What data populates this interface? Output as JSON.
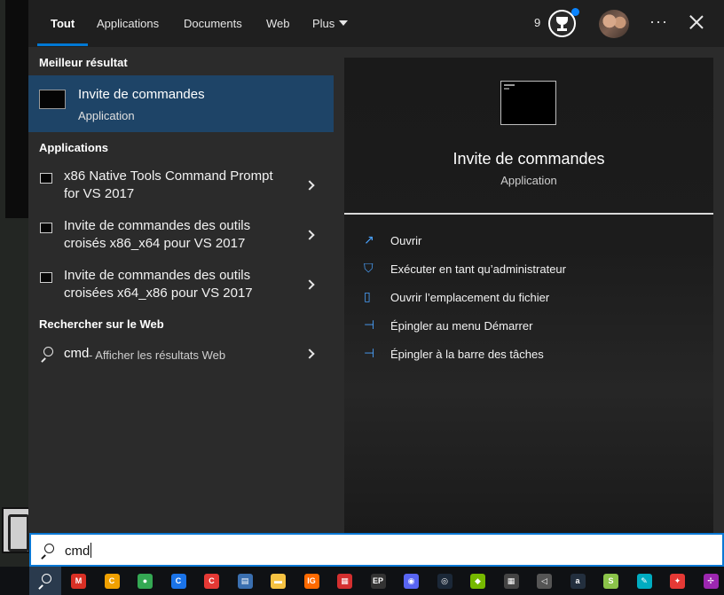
{
  "tabs": [
    {
      "label": "Tout",
      "active": true
    },
    {
      "label": "Applications"
    },
    {
      "label": "Documents"
    },
    {
      "label": "Web"
    },
    {
      "label": "Plus"
    }
  ],
  "header": {
    "badge_count": "9"
  },
  "sections": {
    "best": "Meilleur résultat",
    "apps": "Applications",
    "web": "Rechercher sur le Web"
  },
  "best_match": {
    "title": "Invite de commandes",
    "subtitle": "Application"
  },
  "apps": [
    {
      "line1": "x86 Native Tools Command Prompt",
      "line2": "for VS 2017"
    },
    {
      "line1": "Invite de commandes des outils",
      "line2": "croisés x86_x64 pour VS 2017"
    },
    {
      "line1": "Invite de commandes des outils",
      "line2": "croisées x64_x86 pour VS 2017"
    }
  ],
  "web_result": {
    "query": "cmd",
    "hint": "- Afficher les résultats Web"
  },
  "preview": {
    "title": "Invite de commandes",
    "subtitle": "Application"
  },
  "actions": [
    {
      "label": "Ouvrir",
      "icon": "open-icon"
    },
    {
      "label": "Exécuter en tant qu’administrateur",
      "icon": "shield-icon"
    },
    {
      "label": "Ouvrir l’emplacement du fichier",
      "icon": "file-location-icon"
    },
    {
      "label": "Épingler au menu Démarrer",
      "icon": "pin-icon"
    },
    {
      "label": "Épingler à la barre des tâches",
      "icon": "pin-icon"
    }
  ],
  "search": {
    "value": "cmd"
  },
  "taskbar_apps": [
    {
      "name": "gmail-icon",
      "color": "#d93025",
      "glyph": "M"
    },
    {
      "name": "ccleaner-icon",
      "color": "#f0a000",
      "glyph": "C"
    },
    {
      "name": "chrome-icon",
      "color": "#34a853",
      "glyph": "●"
    },
    {
      "name": "c-app-icon",
      "color": "#1a73e8",
      "glyph": "C"
    },
    {
      "name": "ccleaner-red-icon",
      "color": "#e53935",
      "glyph": "C"
    },
    {
      "name": "media-icon",
      "color": "#3a6fb0",
      "glyph": "▤"
    },
    {
      "name": "folder-icon",
      "color": "#f5c242",
      "glyph": "▬"
    },
    {
      "name": "ig-icon",
      "color": "#ff6a00",
      "glyph": "IG"
    },
    {
      "name": "archive-icon",
      "color": "#d32f2f",
      "glyph": "▦"
    },
    {
      "name": "epic-games-icon",
      "color": "#333333",
      "glyph": "EP"
    },
    {
      "name": "discord-icon",
      "color": "#5865f2",
      "glyph": "◉"
    },
    {
      "name": "steam-icon",
      "color": "#1b2838",
      "glyph": "◎"
    },
    {
      "name": "nvidia-icon",
      "color": "#76b900",
      "glyph": "◆"
    },
    {
      "name": "qr-icon",
      "color": "#444444",
      "glyph": "▦"
    },
    {
      "name": "audio-icon",
      "color": "#555555",
      "glyph": "◁"
    },
    {
      "name": "amazon-icon",
      "color": "#232f3e",
      "glyph": "a"
    },
    {
      "name": "s-app-icon",
      "color": "#8bc34a",
      "glyph": "S"
    },
    {
      "name": "tool-icon",
      "color": "#00acc1",
      "glyph": "✎"
    },
    {
      "name": "msi-icon",
      "color": "#e53935",
      "glyph": "✦"
    },
    {
      "name": "pen-icon",
      "color": "#9c27b0",
      "glyph": "✢"
    }
  ]
}
